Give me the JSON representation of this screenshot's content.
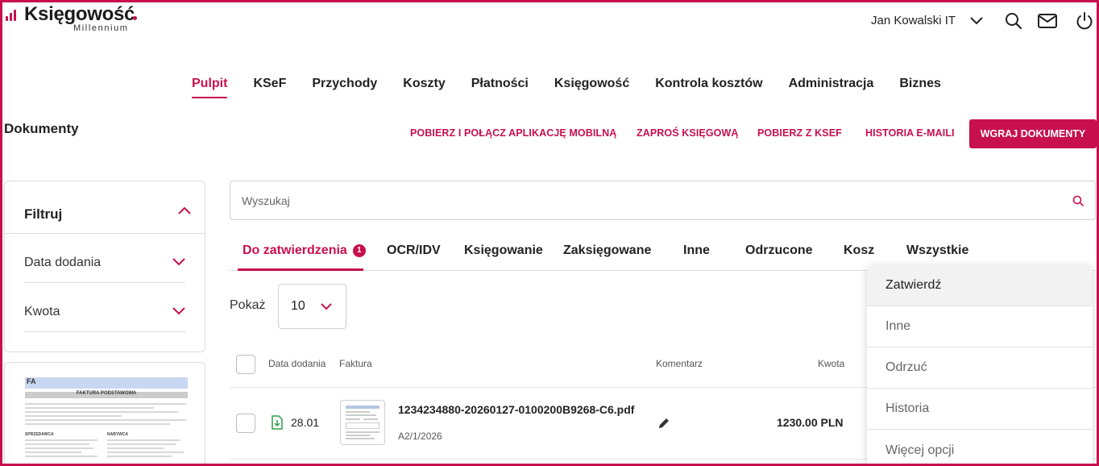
{
  "logo": {
    "brand": "Księgowość",
    "sub": "Millennium"
  },
  "header": {
    "user_name": "Jan Kowalski IT"
  },
  "nav": {
    "items": [
      {
        "label": "Pulpit"
      },
      {
        "label": "KSeF"
      },
      {
        "label": "Przychody"
      },
      {
        "label": "Koszty"
      },
      {
        "label": "Płatności"
      },
      {
        "label": "Księgowość"
      },
      {
        "label": "Kontrola kosztów"
      },
      {
        "label": "Administracja"
      },
      {
        "label": "Biznes"
      }
    ],
    "active": "Pulpit"
  },
  "page": {
    "title": "Dokumenty"
  },
  "actions": {
    "mobile_app": "POBIERZ I POŁĄCZ APLIKACJĘ MOBILNĄ",
    "invite_accountant": "ZAPROŚ KSIĘGOWĄ",
    "download_ksef": "POBIERZ Z KSEF",
    "email_history": "HISTORIA E-MAILI",
    "upload": "WGRAJ DOKUMENTY"
  },
  "filter": {
    "title": "Filtruj",
    "fields": [
      {
        "label": "Data dodania"
      },
      {
        "label": "Kwota"
      }
    ]
  },
  "preview": {
    "doc_code": "FA",
    "doc_title": "FAKTURA PODSTAWOWA",
    "seller_label": "SPRZEDAWCA",
    "buyer_label": "NABYWCA"
  },
  "search": {
    "placeholder": "Wyszukaj",
    "value": ""
  },
  "tabs": {
    "items": [
      {
        "label": "Do zatwierdzenia",
        "badge": "1"
      },
      {
        "label": "OCR/IDV"
      },
      {
        "label": "Księgowanie"
      },
      {
        "label": "Zaksięgowane"
      },
      {
        "label": "Inne"
      },
      {
        "label": "Odrzucone"
      },
      {
        "label": "Kosz"
      },
      {
        "label": "Wszystkie"
      }
    ],
    "active": "Do zatwierdzenia"
  },
  "page_size": {
    "label": "Pokaż",
    "value": "10"
  },
  "table": {
    "columns": {
      "date": "Data dodania",
      "invoice": "Faktura",
      "comment": "Komentarz",
      "amount": "Kwota"
    },
    "rows": [
      {
        "date": "28.01",
        "filename": "1234234880-20260127-0100200B9268-C6.pdf",
        "number": "A2/1/2026",
        "amount": "1230.00 PLN"
      }
    ]
  },
  "context_menu": {
    "items": [
      {
        "label": "Zatwierdź"
      },
      {
        "label": "Inne"
      },
      {
        "label": "Odrzuć"
      },
      {
        "label": "Historia"
      },
      {
        "label": "Więcej opcji"
      }
    ]
  },
  "colors": {
    "accent": "#c8104f",
    "border": "#dcdcdc",
    "text": "#222222"
  }
}
